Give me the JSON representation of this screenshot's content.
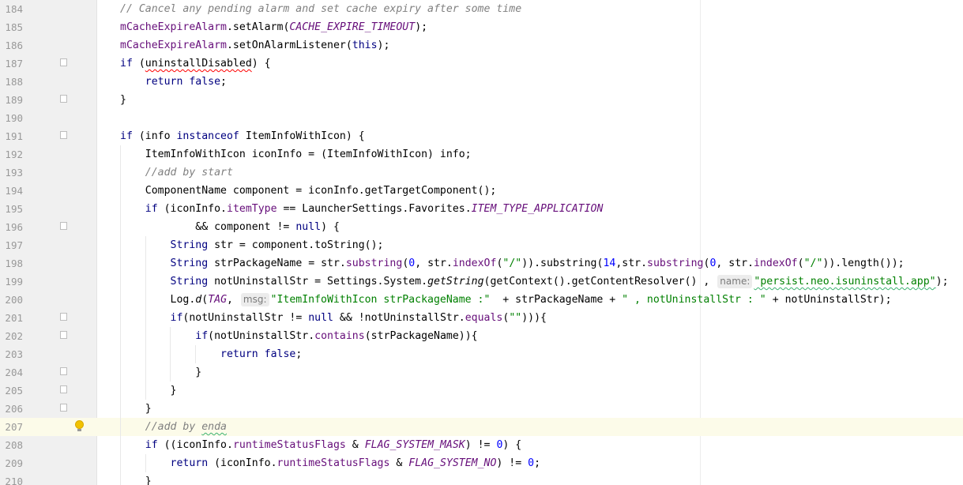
{
  "colors": {
    "background": "#ffffff",
    "gutter": "#f0f0f0",
    "line_number": "#999999",
    "comment": "#808080",
    "keyword": "#000080",
    "field": "#660e7a",
    "string": "#008000",
    "number": "#0000ff",
    "current_line": "#fcfbe9",
    "hint_background": "#ececec"
  },
  "editor": {
    "line_numbers": [
      "184",
      "185",
      "186",
      "187",
      "188",
      "189",
      "190",
      "191",
      "192",
      "193",
      "194",
      "195",
      "196",
      "197",
      "198",
      "199",
      "200",
      "201",
      "202",
      "203",
      "204",
      "205",
      "206",
      "207",
      "208",
      "209",
      "210"
    ],
    "current_line": "207",
    "fold_marker_lines": [
      "187",
      "189",
      "191",
      "196",
      "201",
      "202",
      "204",
      "205",
      "206"
    ],
    "intention_icon": "lightbulb-icon",
    "lines": [
      {
        "tokens": [
          [
            "c",
            "// Cancel any pending alarm and set cache expiry after some time"
          ]
        ]
      },
      {
        "tokens": [
          [
            "f",
            "mCacheExpireAlarm"
          ],
          [
            "p",
            ".setAlarm("
          ],
          [
            "sf",
            "CACHE_EXPIRE_TIMEOUT"
          ],
          [
            "p",
            ");"
          ]
        ]
      },
      {
        "tokens": [
          [
            "f",
            "mCacheExpireAlarm"
          ],
          [
            "p",
            ".setOnAlarmListener("
          ],
          [
            "k",
            "this"
          ],
          [
            "p",
            ");"
          ]
        ]
      },
      {
        "tokens": [
          [
            "k",
            "if"
          ],
          [
            "p",
            " ("
          ],
          [
            "sq",
            "uninstallDisabled"
          ],
          [
            "p",
            ") {"
          ]
        ]
      },
      {
        "tokens": [
          [
            "p",
            "    "
          ],
          [
            "k",
            "return false"
          ],
          [
            "p",
            ";"
          ]
        ]
      },
      {
        "tokens": [
          [
            "p",
            "}"
          ]
        ]
      },
      {
        "tokens": [
          [
            "p",
            ""
          ]
        ]
      },
      {
        "tokens": [
          [
            "k",
            "if"
          ],
          [
            "p",
            " (info "
          ],
          [
            "k",
            "instanceof"
          ],
          [
            "p",
            " ItemInfoWithIcon) {"
          ]
        ]
      },
      {
        "tokens": [
          [
            "p",
            "    ItemInfoWithIcon iconInfo = (ItemInfoWithIcon) info;"
          ]
        ]
      },
      {
        "tokens": [
          [
            "p",
            "    "
          ],
          [
            "c",
            "//add by start"
          ]
        ]
      },
      {
        "tokens": [
          [
            "p",
            "    ComponentName component = iconInfo.getTargetComponent();"
          ]
        ]
      },
      {
        "tokens": [
          [
            "p",
            "    "
          ],
          [
            "k",
            "if"
          ],
          [
            "p",
            " (iconInfo."
          ],
          [
            "f",
            "itemType"
          ],
          [
            "p",
            " == LauncherSettings.Favorites."
          ],
          [
            "sf",
            "ITEM_TYPE_APPLICATION"
          ]
        ]
      },
      {
        "tokens": [
          [
            "p",
            "            && component != "
          ],
          [
            "k",
            "null"
          ],
          [
            "p",
            ") {"
          ]
        ]
      },
      {
        "tokens": [
          [
            "p",
            "        "
          ],
          [
            "k",
            "String"
          ],
          [
            "p",
            " str = component.toString();"
          ]
        ]
      },
      {
        "tokens": [
          [
            "p",
            "        "
          ],
          [
            "k",
            "String"
          ],
          [
            "p",
            " strPackageName = str."
          ],
          [
            "f",
            "substring"
          ],
          [
            "p",
            "("
          ],
          [
            "n",
            "0"
          ],
          [
            "p",
            ", str."
          ],
          [
            "f",
            "indexOf"
          ],
          [
            "p",
            "("
          ],
          [
            "s",
            "\"/\""
          ],
          [
            "p",
            ")).substring("
          ],
          [
            "n",
            "14"
          ],
          [
            "p",
            ",str."
          ],
          [
            "f",
            "substring"
          ],
          [
            "p",
            "("
          ],
          [
            "n",
            "0"
          ],
          [
            "p",
            ", str."
          ],
          [
            "f",
            "indexOf"
          ],
          [
            "p",
            "("
          ],
          [
            "s",
            "\"/\""
          ],
          [
            "p",
            ")).length());"
          ]
        ]
      },
      {
        "tokens": [
          [
            "p",
            "        "
          ],
          [
            "k",
            "String"
          ],
          [
            "p",
            " notUninstallStr = Settings.System."
          ],
          [
            "it",
            "getString"
          ],
          [
            "p",
            "(getContext().getContentResolver() , "
          ],
          [
            "h",
            "name:"
          ],
          [
            "sg",
            "\"persist.neo.isuninstall.app\""
          ],
          [
            "p",
            ");"
          ]
        ]
      },
      {
        "tokens": [
          [
            "p",
            "        Log."
          ],
          [
            "it",
            "d"
          ],
          [
            "p",
            "("
          ],
          [
            "sf",
            "TAG"
          ],
          [
            "p",
            ", "
          ],
          [
            "h",
            "msg:"
          ],
          [
            "s",
            "\"ItemInfoWithIcon strPackageName :\""
          ],
          [
            "p",
            "  + strPackageName + "
          ],
          [
            "s",
            "\" , notUninstallStr : \""
          ],
          [
            "p",
            " + notUninstallStr);"
          ]
        ]
      },
      {
        "tokens": [
          [
            "p",
            "        "
          ],
          [
            "k",
            "if"
          ],
          [
            "p",
            "(notUninstallStr != "
          ],
          [
            "k",
            "null"
          ],
          [
            "p",
            " && !notUninstallStr."
          ],
          [
            "f",
            "equals"
          ],
          [
            "p",
            "("
          ],
          [
            "s",
            "\"\""
          ],
          [
            "p",
            "))){"
          ]
        ]
      },
      {
        "tokens": [
          [
            "p",
            "            "
          ],
          [
            "k",
            "if"
          ],
          [
            "p",
            "(notUninstallStr."
          ],
          [
            "f",
            "contains"
          ],
          [
            "p",
            "(strPackageName)){"
          ]
        ]
      },
      {
        "tokens": [
          [
            "p",
            "                "
          ],
          [
            "k",
            "return false"
          ],
          [
            "p",
            ";"
          ]
        ]
      },
      {
        "tokens": [
          [
            "p",
            "            }"
          ]
        ]
      },
      {
        "tokens": [
          [
            "p",
            "        }"
          ]
        ]
      },
      {
        "tokens": [
          [
            "p",
            "    }"
          ]
        ]
      },
      {
        "tokens": [
          [
            "p",
            "    "
          ],
          [
            "c",
            "//add by "
          ],
          [
            "csq",
            "enda"
          ]
        ]
      },
      {
        "tokens": [
          [
            "p",
            "    "
          ],
          [
            "k",
            "if"
          ],
          [
            "p",
            " ((iconInfo."
          ],
          [
            "f",
            "runtimeStatusFlags"
          ],
          [
            "p",
            " & "
          ],
          [
            "sf",
            "FLAG_SYSTEM_MASK"
          ],
          [
            "p",
            ") != "
          ],
          [
            "n",
            "0"
          ],
          [
            "p",
            ") {"
          ]
        ]
      },
      {
        "tokens": [
          [
            "p",
            "        "
          ],
          [
            "k",
            "return"
          ],
          [
            "p",
            " (iconInfo."
          ],
          [
            "f",
            "runtimeStatusFlags"
          ],
          [
            "p",
            " & "
          ],
          [
            "sf",
            "FLAG_SYSTEM_NO"
          ],
          [
            "p",
            ") != "
          ],
          [
            "n",
            "0"
          ],
          [
            "p",
            ";"
          ]
        ]
      },
      {
        "tokens": [
          [
            "p",
            "    }"
          ]
        ]
      }
    ]
  }
}
